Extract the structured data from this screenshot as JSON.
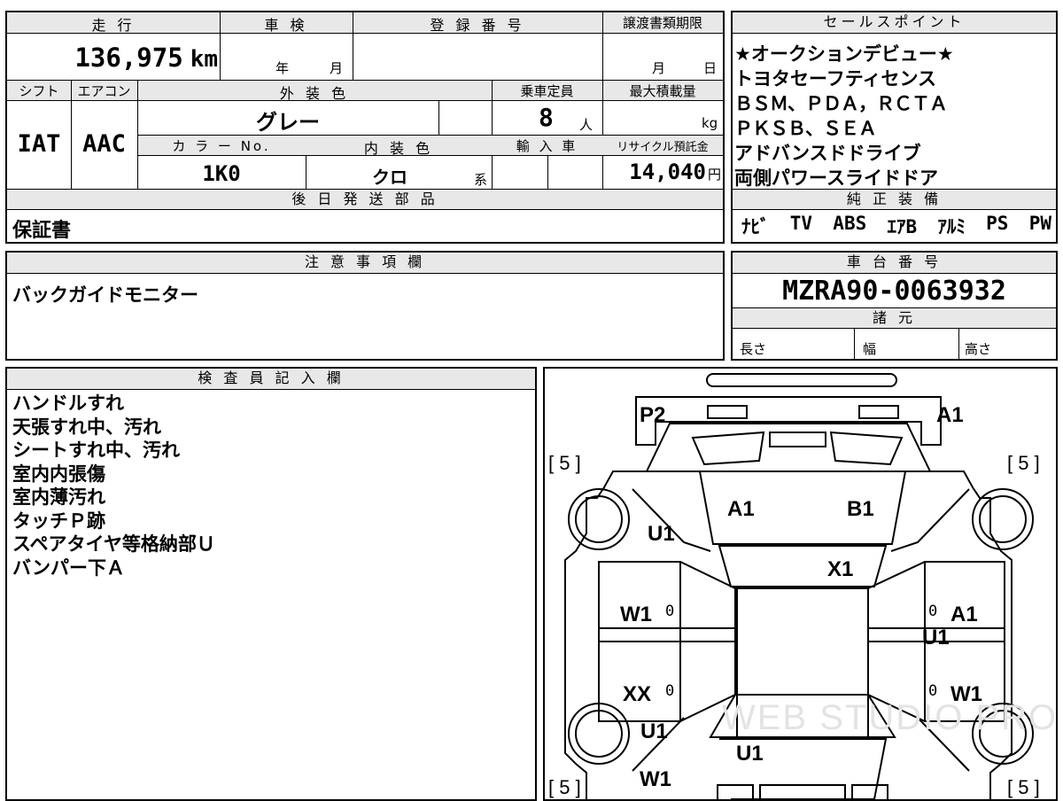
{
  "vehicle": {
    "mileage_header": "走 行",
    "mileage": "136,975",
    "mileage_unit": "km",
    "inspection_header": "車 検",
    "inspection_year_label": "年",
    "inspection_month_label": "月",
    "registration_header": "登 録 番 号",
    "transfer_header": "譲渡書類期限",
    "transfer_month_label": "月",
    "transfer_day_label": "日",
    "shift_header": "シフト",
    "shift": "IAT",
    "ac_header": "エアコン",
    "ac": "AAC",
    "exterior_header": "外 装 色",
    "exterior_color": "グレー",
    "seats_header": "乗車定員",
    "seats": "8",
    "seats_unit": "人",
    "max_load_header": "最大積載量",
    "max_load_unit": "kg",
    "color_no_header": "カ ラ ー No.",
    "color_no": "1K0",
    "interior_header": "内 装 色",
    "interior_color": "クロ",
    "interior_suffix": "系",
    "import_header": "輸 入 車",
    "recycle_header": "リサイクル預託金",
    "recycle_fee": "14,040",
    "recycle_unit": "円",
    "later_parts_header": "後 日 発 送 部 品",
    "later_parts": "保証書"
  },
  "sales_points": {
    "header": "セールスポイント",
    "lines": [
      "★オークションデビュー★",
      "トヨタセーフティセンス",
      "ＢＳＭ、ＰＤＡ，ＲＣＴＡ",
      "ＰＫＳＢ、ＳＥＡ",
      "アドバンスドドライブ",
      "両側パワースライドドア"
    ]
  },
  "equipment": {
    "header": "純 正 装 備",
    "items": [
      "ﾅﾋﾞ",
      "TV",
      "ABS",
      "ｴｱB",
      "ｱﾙﾐ",
      "PS",
      "PW"
    ]
  },
  "notes": {
    "header": "注 意 事 項 欄",
    "text": "バックガイドモニター"
  },
  "chassis": {
    "header": "車 台 番 号",
    "number": "MZRA90-0063932",
    "spec_header": "諸 元",
    "length_label": "長さ",
    "width_label": "幅",
    "height_label": "高さ"
  },
  "inspector": {
    "header": "検 査 員 記 入 欄",
    "lines": [
      "ハンドルすれ",
      "天張すれ中、汚れ",
      "シートすれ中、汚れ",
      "室内内張傷",
      "室内薄汚れ",
      "タッチＰ跡",
      "スペアタイヤ等格納部Ｕ",
      "バンパー下Ａ"
    ]
  },
  "diagram": {
    "tyre_marks": [
      "[ 5 ]",
      "[ 5 ]",
      "[ 5 ]",
      "[ 5 ]"
    ],
    "zero_marks": [
      "0",
      "0",
      "0",
      "0"
    ],
    "damage_labels": {
      "rear_left": "P2",
      "rear_right": "A1",
      "rear_glass_left": "A1",
      "rear_glass_right": "B1",
      "rear_quarter_left": "U1",
      "roof": "X1",
      "left_rear_door": "W1",
      "right_rear_door": "A1",
      "right_rear_door_2": "U1",
      "left_front_door": "XX",
      "right_front_door": "W1",
      "left_front_fender": "U1",
      "hood": "U1",
      "left_front_bumper": "W1"
    },
    "watermark": "WEB STUDIO PRO"
  }
}
